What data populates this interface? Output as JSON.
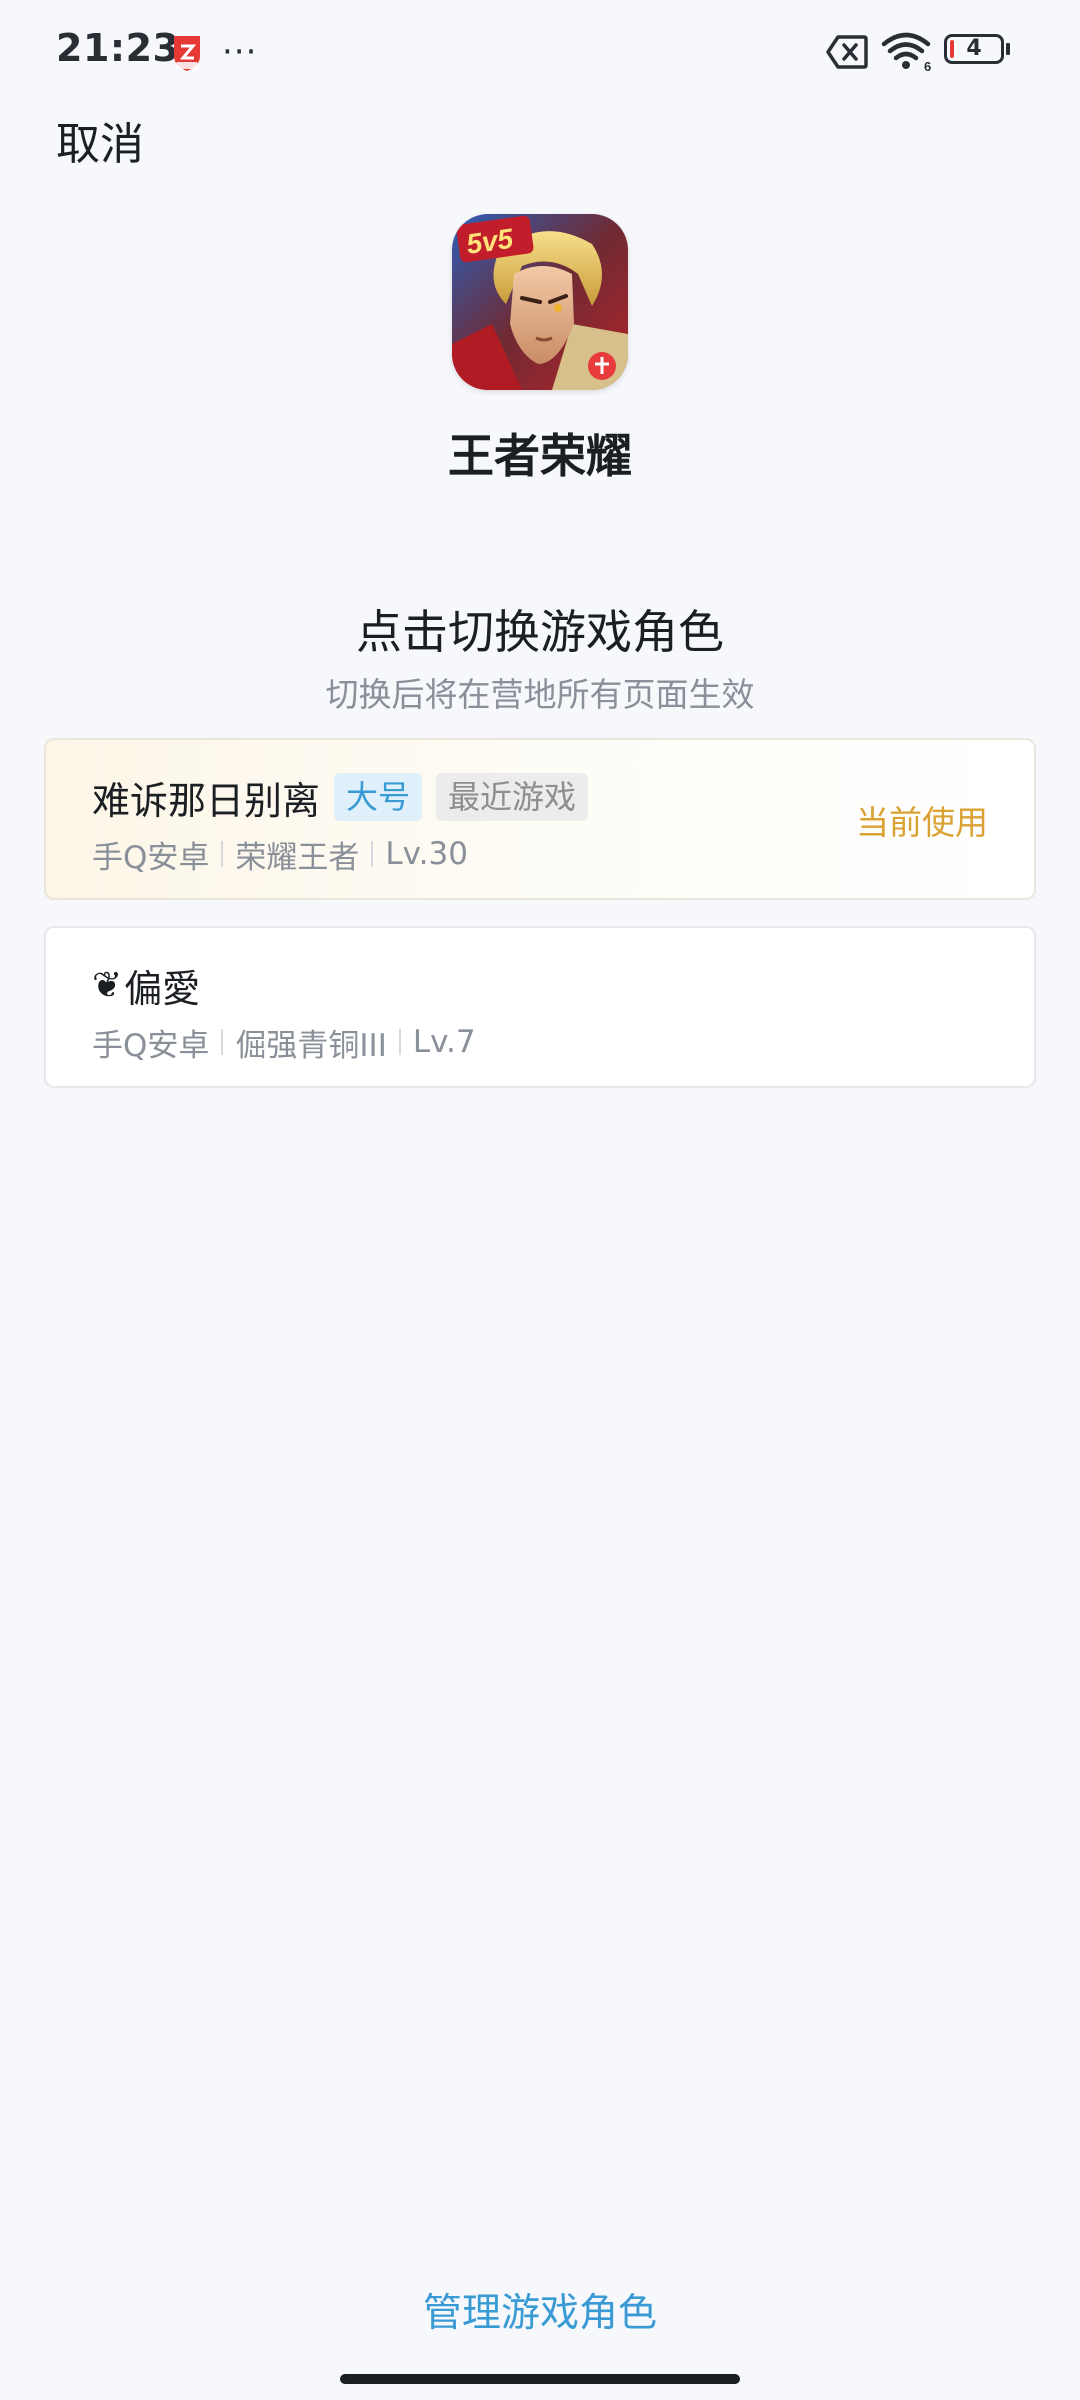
{
  "status_bar": {
    "time": "21:23",
    "more": "···",
    "battery": "4",
    "wifi_badge": "6",
    "icons": [
      "app-notification-icon",
      "sim-error-icon",
      "wifi-icon",
      "battery-icon"
    ]
  },
  "nav": {
    "cancel_label": "取消"
  },
  "app": {
    "name": "王者荣耀",
    "icon_badge": "5v5",
    "icon": "game-app-icon"
  },
  "section": {
    "title": "点击切换游戏角色",
    "subtitle": "切换后将在营地所有页面生效"
  },
  "roles": [
    {
      "name": "难诉那日别离",
      "tags": [
        "大号",
        "最近游戏"
      ],
      "meta": [
        "手Q安卓",
        "荣耀王者",
        "Lv.30"
      ],
      "status": "当前使用",
      "active": true
    },
    {
      "prefix": "❦",
      "name": "偏愛",
      "tags": [],
      "meta": [
        "手Q安卓",
        "倔强青铜III",
        "Lv.7"
      ],
      "status": "",
      "active": false
    }
  ],
  "footer": {
    "manage_label": "管理游戏角色"
  },
  "colors": {
    "background": "#f6f8fc",
    "accent_blue": "#3a9bd4",
    "accent_gold": "#d9a233",
    "muted_text": "#8a9099"
  }
}
